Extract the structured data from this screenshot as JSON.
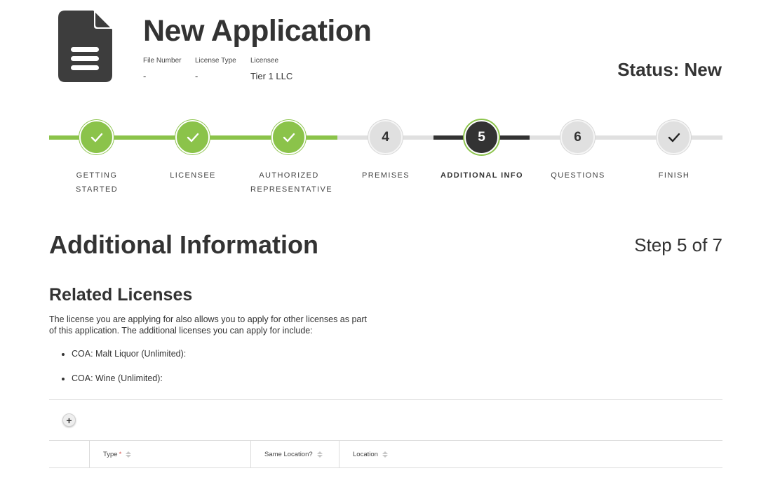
{
  "header": {
    "title": "New Application",
    "meta": [
      {
        "label": "File Number",
        "value": "-"
      },
      {
        "label": "License Type",
        "value": "-"
      },
      {
        "label": "Licensee",
        "value": "Tier 1 LLC"
      }
    ],
    "status": "Status: New",
    "icon": "document-icon"
  },
  "stepper": {
    "steps": [
      {
        "number": "",
        "label": "Getting Started",
        "state": "done"
      },
      {
        "number": "",
        "label": "Licensee",
        "state": "done"
      },
      {
        "number": "",
        "label": "Authorized Representative",
        "state": "done"
      },
      {
        "number": "4",
        "label": "Premises",
        "state": "todo"
      },
      {
        "number": "5",
        "label": "Additional Info",
        "state": "active"
      },
      {
        "number": "6",
        "label": "Questions",
        "state": "todo"
      },
      {
        "number": "",
        "label": "Finish",
        "state": "finish"
      }
    ],
    "colors": {
      "done": "#8bc34a",
      "active": "#333333",
      "todo": "#e0e0e0"
    }
  },
  "main": {
    "section_title": "Additional Information",
    "step_count": "Step 5 of 7",
    "subsection_title": "Related Licenses",
    "description": "The license you are applying for also allows you to apply for other licenses as part of this application. The additional licenses you can apply for include:",
    "licenses": [
      "COA: Malt Liquor (Unlimited):",
      "COA: Wine (Unlimited):"
    ],
    "add_button": "+",
    "table": {
      "columns": [
        {
          "label": "Type",
          "required": "*"
        },
        {
          "label": "Same Location?"
        },
        {
          "label": "Location"
        }
      ]
    }
  }
}
